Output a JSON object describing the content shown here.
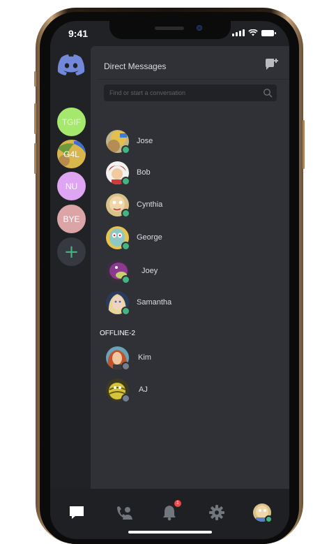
{
  "status_bar": {
    "time": "9:41"
  },
  "guilds": [
    {
      "label": "TGIF",
      "color": "#a6e86e"
    },
    {
      "label": "G4L",
      "color": "#c7a24a"
    },
    {
      "label": "NU",
      "color": "#dea6f2"
    },
    {
      "label": "BYE",
      "color": "#dba5a8"
    }
  ],
  "add_server_label": "+",
  "dm": {
    "header": "Direct Messages",
    "search_placeholder": "Find or start a conversation",
    "online": [
      {
        "name": "Jose",
        "status": "online"
      },
      {
        "name": "Bob",
        "status": "online"
      },
      {
        "name": "Cynthia",
        "status": "online"
      },
      {
        "name": "George",
        "status": "online"
      },
      {
        "name": "Joey",
        "status": "online"
      },
      {
        "name": "Samantha",
        "status": "online"
      }
    ],
    "offline_header": "OFFLINE-2",
    "offline": [
      {
        "name": "Kim",
        "status": "offline"
      },
      {
        "name": "AJ",
        "status": "offline"
      }
    ]
  },
  "tab_bar": {
    "notifications_badge": "1",
    "tabs": [
      "chat-icon",
      "friends-icon",
      "bell-icon",
      "gear-icon",
      "profile-avatar"
    ]
  },
  "colors": {
    "online": "#43b581",
    "offline": "#747f8d",
    "blurple": "#7289da",
    "badge": "#f04747"
  }
}
